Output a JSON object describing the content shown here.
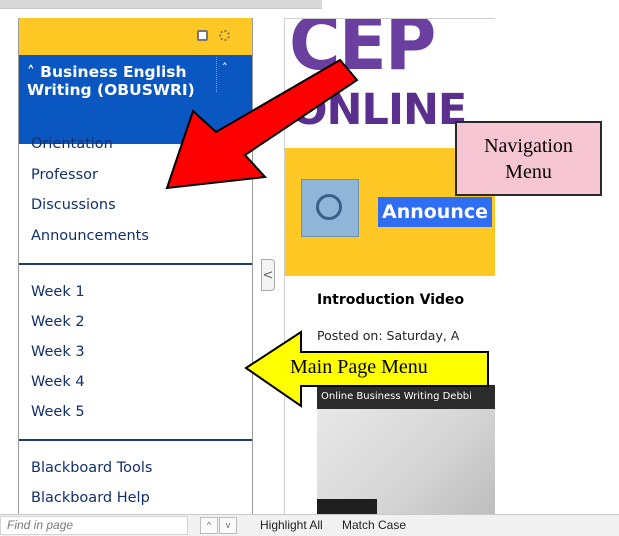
{
  "course_menu": {
    "course_title": "Business English Writing (OBUSWRI)",
    "collapse_glyph": "˄",
    "title_glyph": "˄",
    "nav_items": [
      "Orientation",
      "Professor",
      "Discussions",
      "Announcements"
    ],
    "week_items": [
      "Week 1",
      "Week 2",
      "Week 3",
      "Week 4",
      "Week 5"
    ],
    "tool_items": [
      "Blackboard Tools",
      "Blackboard Help"
    ],
    "accent_color": "#0a57c2",
    "topbar_color": "#ffc825"
  },
  "content": {
    "logo_line1": "CEP",
    "logo_line2": "ONLINE",
    "announce_title": "Announce",
    "video_title": "Introduction Video",
    "posted_on": "Posted on: Saturday, A",
    "video_caption": "Online Business Writing Debbi",
    "collapse_handle_glyph": "<"
  },
  "annotations": {
    "nav_label_line1": "Navigation",
    "nav_label_line2": "Menu",
    "main_menu_label": "Main Page Menu",
    "red_arrow_color": "#ff0000",
    "yellow_arrow_color": "#ffff00"
  },
  "find_bar": {
    "placeholder": "Find in page",
    "prev_glyph": "^",
    "next_glyph": "v",
    "highlight_all": "Highlight All",
    "match_case": "Match Case"
  }
}
